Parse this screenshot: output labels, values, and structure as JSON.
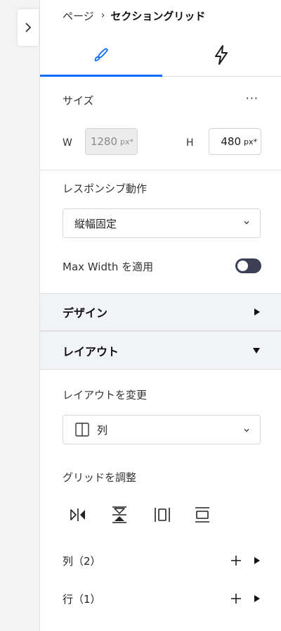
{
  "breadcrumb": {
    "parent": "ページ",
    "separator": "›",
    "current": "セクショングリッド"
  },
  "tabs": [
    {
      "id": "design",
      "icon": "paintbrush-icon",
      "active": true
    },
    {
      "id": "interactions",
      "icon": "lightning-icon",
      "active": false
    }
  ],
  "size": {
    "title": "サイズ",
    "more": "···",
    "width": {
      "label": "W",
      "value": "1280",
      "unit": "px*",
      "disabled": true
    },
    "height": {
      "label": "H",
      "value": "480",
      "unit": "px*",
      "disabled": false
    }
  },
  "responsive": {
    "title": "レスポンシブ動作",
    "selected": "縦幅固定"
  },
  "max_width": {
    "label": "Max Width を適用",
    "enabled": false
  },
  "sections": {
    "design": {
      "title": "デザイン",
      "expanded": false
    },
    "layout": {
      "title": "レイアウト",
      "expanded": true
    }
  },
  "layout": {
    "change_title": "レイアウトを変更",
    "selected": "列",
    "selected_icon": "columns-icon",
    "grid_title": "グリッドを調整",
    "grid_tools": [
      "flip-horizontal-icon",
      "flip-vertical-icon",
      "distribute-columns-icon",
      "distribute-rows-icon"
    ],
    "columns": {
      "label": "列（2）"
    },
    "rows": {
      "label": "行（1）"
    }
  },
  "colors": {
    "accent": "#116dff",
    "toggle_off": "#3b4057",
    "section_bg": "#f2f3f7"
  }
}
